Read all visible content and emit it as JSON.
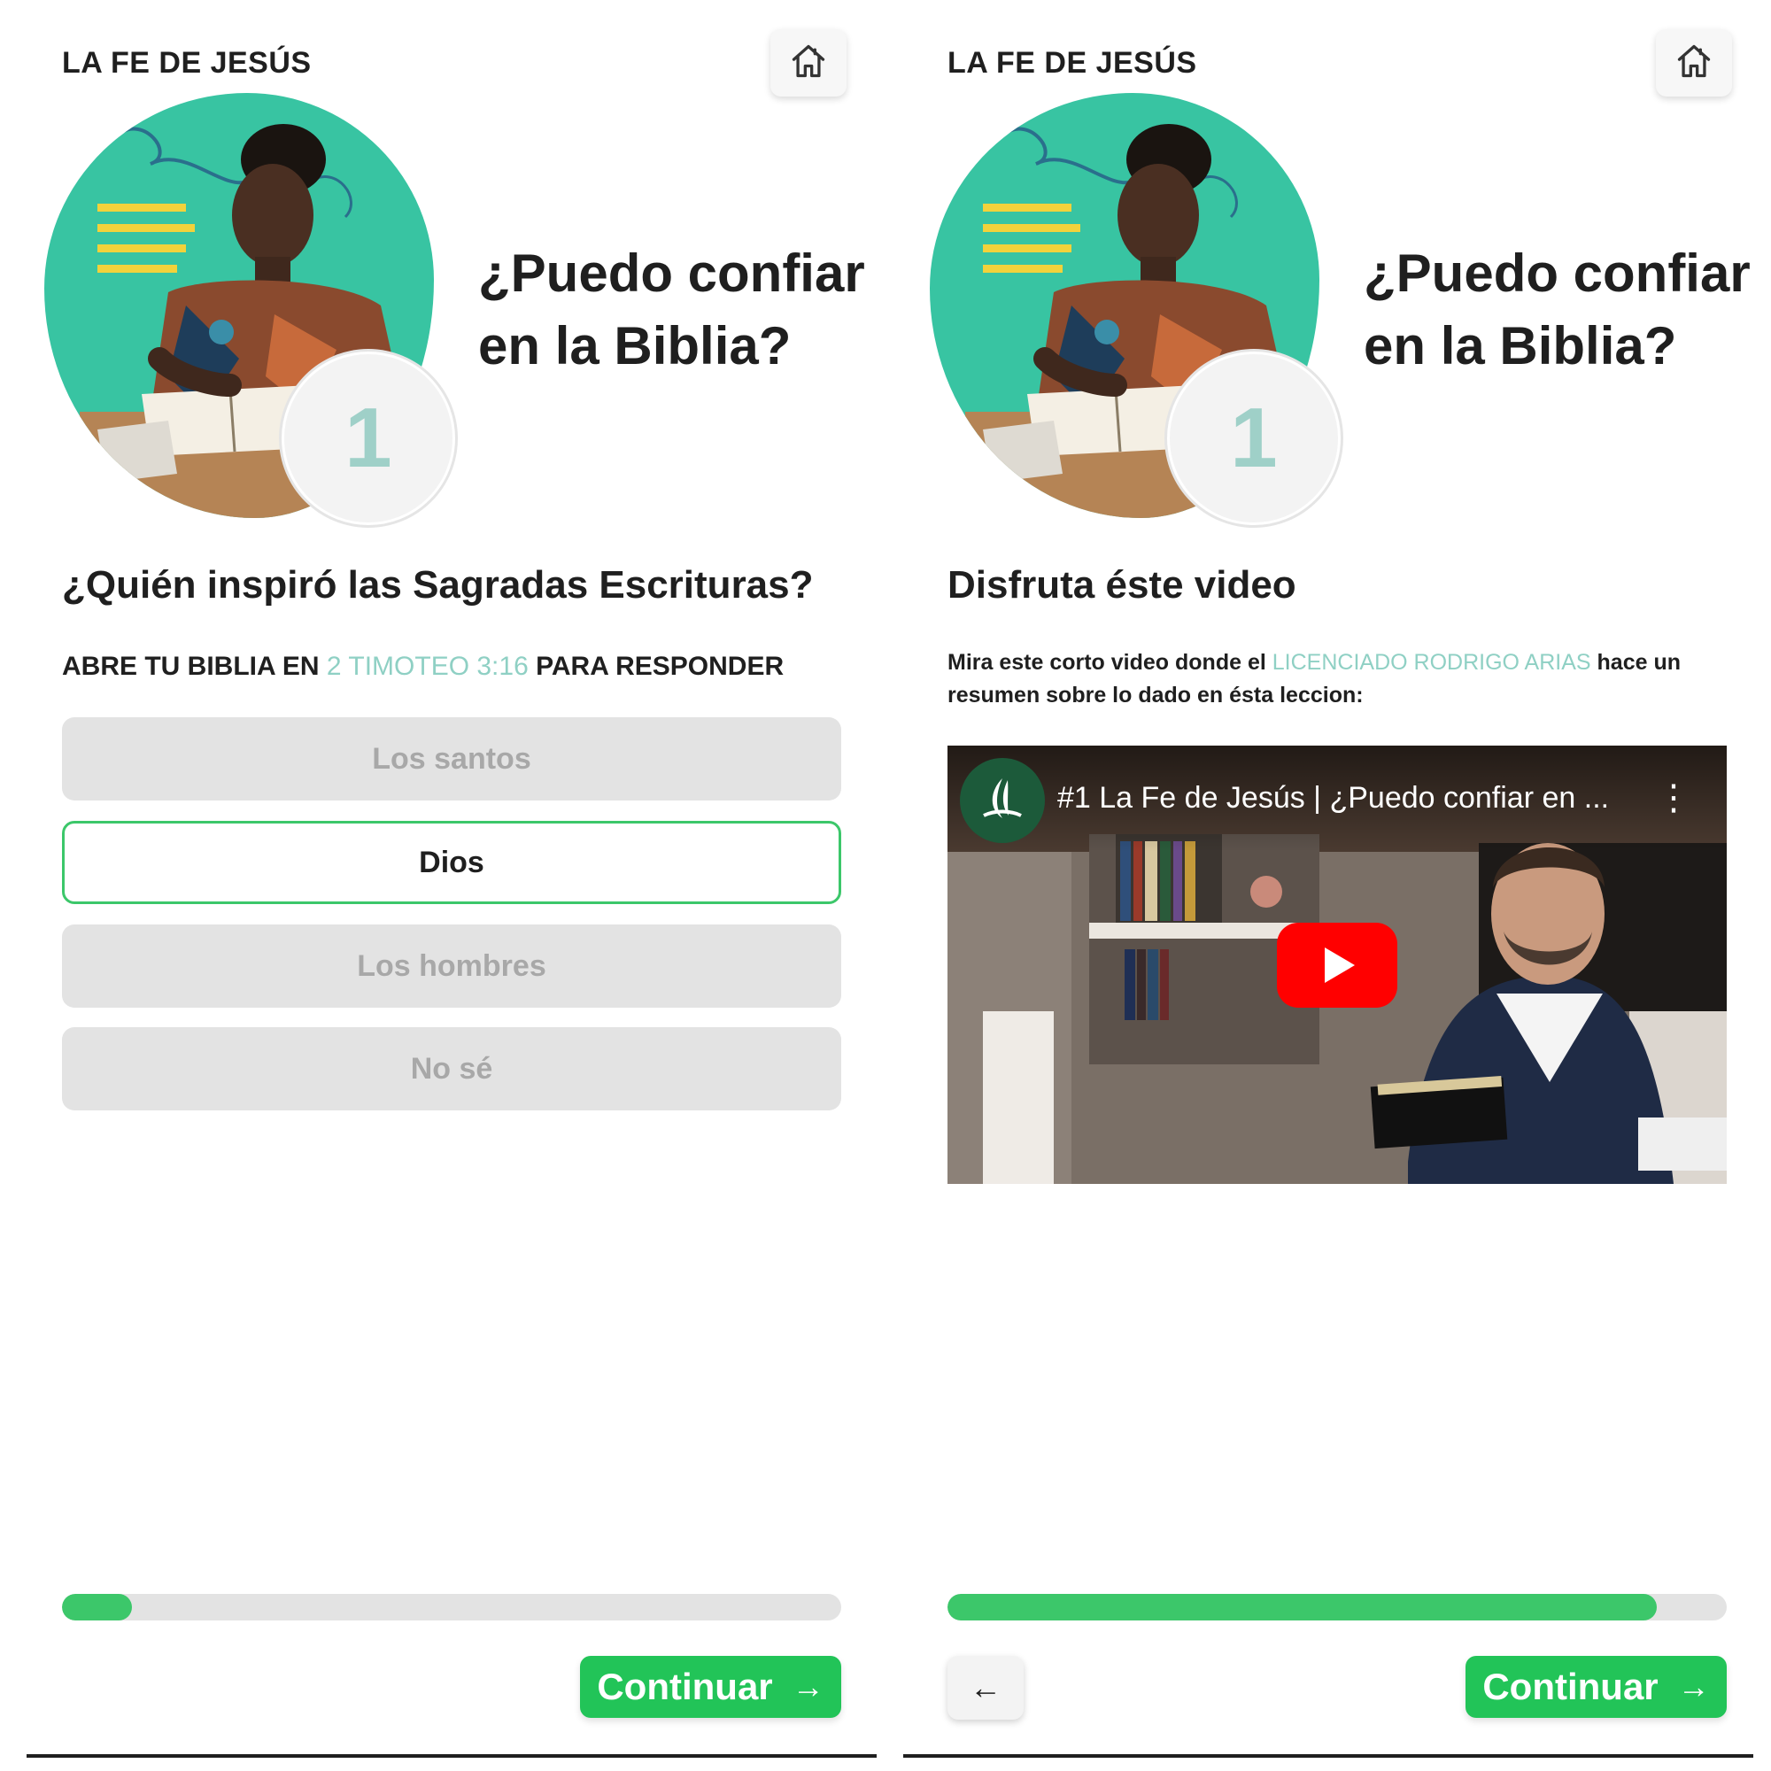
{
  "screens": [
    {
      "app_title": "LA FE DE JESÚS",
      "lesson": {
        "number": "1",
        "title": "¿Puedo confiar en la Biblia?"
      },
      "question": "¿Quién inspiró las Sagradas Escrituras?",
      "instruction": {
        "prefix": "ABRE TU BIBLIA EN",
        "verse": "2 TIMOTEO 3:16",
        "suffix": "PARA RESPONDER"
      },
      "options": [
        {
          "label": "Los santos",
          "selected": false
        },
        {
          "label": "Dios",
          "selected": true
        },
        {
          "label": "Los hombres",
          "selected": false
        },
        {
          "label": "No sé",
          "selected": false
        }
      ],
      "progress": 0.09,
      "continue_label": "Continuar",
      "icons": {
        "home": "home-icon",
        "continue": "arrow-right-icon"
      }
    },
    {
      "app_title": "LA FE DE JESÚS",
      "lesson": {
        "number": "1",
        "title": "¿Puedo confiar en la Biblia?"
      },
      "section_title": "Disfruta éste video",
      "description": {
        "prefix": "Mira este corto video donde el",
        "presenter": "LICENCIADO RODRIGO ARIAS",
        "suffix": "hace un resumen sobre lo dado en ésta leccion:"
      },
      "video": {
        "title": "#1 La Fe de Jesús | ¿Puedo confiar en ..."
      },
      "progress": 0.91,
      "continue_label": "Continuar",
      "icons": {
        "home": "home-icon",
        "back": "arrow-left-icon",
        "continue": "arrow-right-icon",
        "play": "play-icon",
        "more": "more-vertical-icon"
      }
    }
  ],
  "colors": {
    "accent_green": "#22c458",
    "teal_link": "#8fd0c4",
    "blob_teal": "#38c4a2",
    "youtube_red": "#ff0000"
  }
}
